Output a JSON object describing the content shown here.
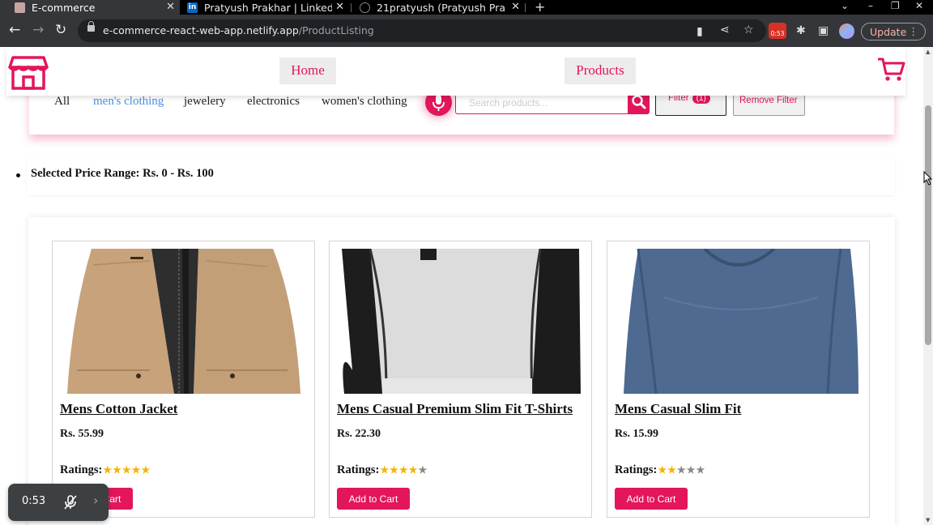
{
  "browser": {
    "tabs": [
      {
        "title": "E-commerce",
        "active": true
      },
      {
        "title": "Pratyush Prakhar | Linked",
        "active": false
      },
      {
        "title": "21pratyush (Pratyush Pra",
        "active": false
      }
    ],
    "url_host": "e-commerce-react-web-app.netlify.app",
    "url_path": "/ProductListing",
    "recording_badge": "0:53",
    "update_label": "Update"
  },
  "header": {
    "nav": [
      {
        "label": "Home"
      },
      {
        "label": "Products"
      }
    ]
  },
  "filters": {
    "categories": [
      {
        "label": "All",
        "selected": false
      },
      {
        "label": "men's clothing",
        "selected": true
      },
      {
        "label": "jewelery",
        "selected": false
      },
      {
        "label": "electronics",
        "selected": false
      },
      {
        "label": "women's clothing",
        "selected": false
      }
    ],
    "search_placeholder": "Search products...",
    "filter_label": "Filter",
    "filter_count": "(1)",
    "remove_filter_label": "Remove Filter"
  },
  "price_range": {
    "text": "Selected Price Range: Rs. 0 - Rs. 100"
  },
  "products": [
    {
      "title": "Mens Cotton Jacket",
      "price": "Rs. 55.99",
      "ratings_label": "Ratings:",
      "rating": 5,
      "add_label": "Add to Cart",
      "image": "jacket"
    },
    {
      "title": "Mens Casual Premium Slim Fit T-Shirts",
      "price": "Rs. 22.30",
      "ratings_label": "Ratings:",
      "rating": 4,
      "add_label": "Add to Cart",
      "image": "raglan-tshirt"
    },
    {
      "title": "Mens Casual Slim Fit",
      "price": "Rs. 15.99",
      "ratings_label": "Ratings:",
      "rating": 2,
      "add_label": "Add to Cart",
      "image": "blue-longsleeve"
    }
  ],
  "recorder": {
    "time": "0:53"
  },
  "colors": {
    "brand": "#e3165b",
    "selected_category": "#4a90e2",
    "star": "#f4b400"
  }
}
